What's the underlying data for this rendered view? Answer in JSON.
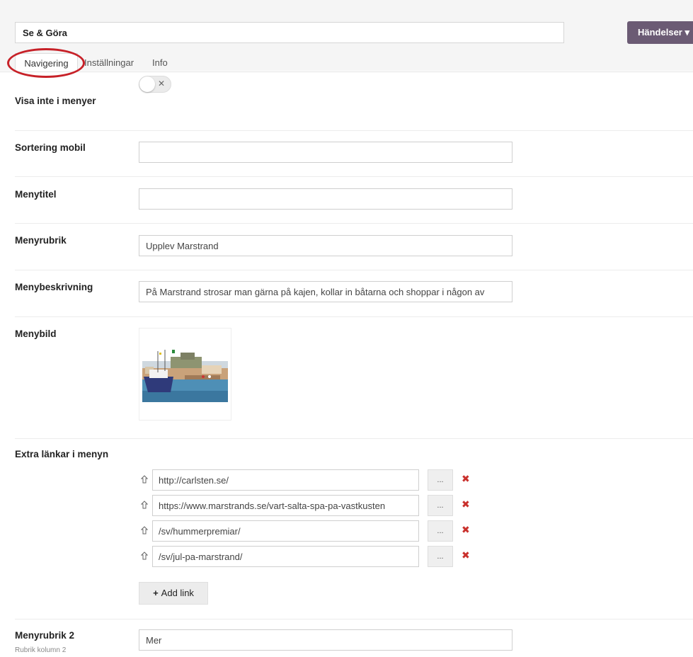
{
  "header": {
    "page_name": "Se & Göra",
    "events_button": "Händelser",
    "events_caret": "▾"
  },
  "tabs": [
    {
      "label": "Navigering",
      "active": true
    },
    {
      "label": "Inställningar",
      "active": false
    },
    {
      "label": "Info",
      "active": false
    }
  ],
  "fields": {
    "hide_in_menus": {
      "label": "Visa inte i menyer",
      "value": false,
      "off_symbol": "✕"
    },
    "sort_mobile": {
      "label": "Sortering mobil",
      "value": ""
    },
    "menu_title": {
      "label": "Menytitel",
      "value": ""
    },
    "menu_heading": {
      "label": "Menyrubrik",
      "value": "Upplev Marstrand"
    },
    "menu_description": {
      "label": "Menybeskrivning",
      "value": "På Marstrand strosar man gärna på kajen, kollar in båtarna och shoppar i någon av"
    },
    "menu_image": {
      "label": "Menybild"
    },
    "extra_links": {
      "label": "Extra länkar i menyn",
      "browse_label": "...",
      "remove_symbol": "✖",
      "items": [
        {
          "url": "http://carlsten.se/"
        },
        {
          "url": "https://www.marstrands.se/vart-salta-spa-pa-vastkusten"
        },
        {
          "url": "/sv/hummerpremiar/"
        },
        {
          "url": "/sv/jul-pa-marstrand/"
        }
      ],
      "add_label": "Add link",
      "add_symbol": "+"
    },
    "menu_heading_2": {
      "label": "Menyrubrik 2",
      "sublabel": "Rubrik kolumn 2",
      "value": "Mer"
    }
  },
  "colors": {
    "accent": "#6b5b74",
    "highlight_ring": "#c72128",
    "remove": "#c9302c"
  }
}
